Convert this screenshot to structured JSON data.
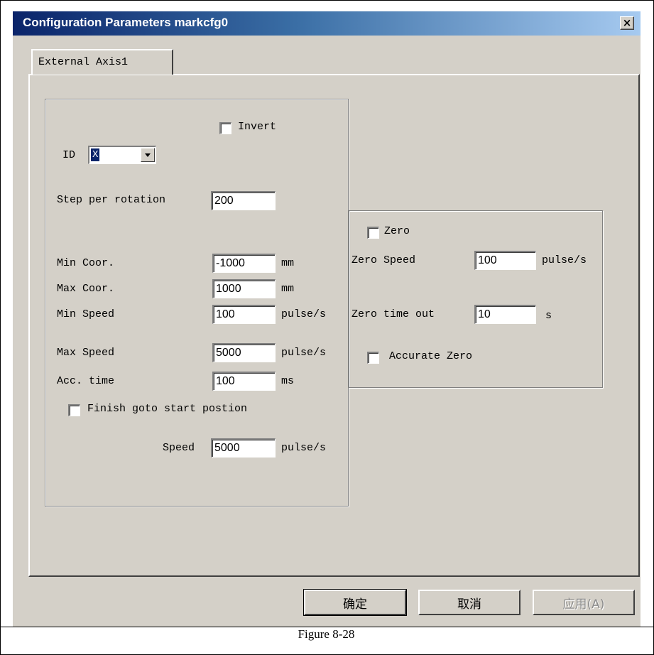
{
  "window": {
    "title": "Configuration Parameters markcfg0",
    "close_glyph": "×"
  },
  "tabs": [
    {
      "label": "External Axis1",
      "active": true
    }
  ],
  "axis": {
    "invert_label": "Invert",
    "invert_checked": false,
    "id_label": "ID",
    "id_value": "X",
    "step_label": "Step per rotation",
    "step_value": "200",
    "rows": [
      {
        "label": "Min Coor.",
        "value": "-1000",
        "unit": "mm"
      },
      {
        "label": "Max Coor.",
        "value": "1000",
        "unit": "mm"
      },
      {
        "label": "Min Speed",
        "value": "100",
        "unit": "pulse/s"
      },
      {
        "label": "Max Speed",
        "value": "5000",
        "unit": "pulse/s"
      },
      {
        "label": "Acc. time",
        "value": "100",
        "unit": "ms"
      }
    ],
    "finish_label": "Finish goto start postion",
    "finish_checked": false,
    "speed_label": "Speed",
    "speed_value": "5000",
    "speed_unit": "pulse/s"
  },
  "zero": {
    "zero_label": "Zero",
    "zero_checked": false,
    "zero_speed_label": "Zero Speed",
    "zero_speed_value": "100",
    "zero_speed_unit": "pulse/s",
    "timeout_label": "Zero time out",
    "timeout_value": "10",
    "timeout_unit": "s",
    "accurate_label": "Accurate Zero",
    "accurate_checked": false
  },
  "buttons": {
    "ok": "确定",
    "cancel": "取消",
    "apply": "应用(A)"
  },
  "caption": "Figure 8-28",
  "colors": {
    "face": "#d4d0c8",
    "title_start": "#0a246a",
    "title_end": "#a6caf0"
  }
}
